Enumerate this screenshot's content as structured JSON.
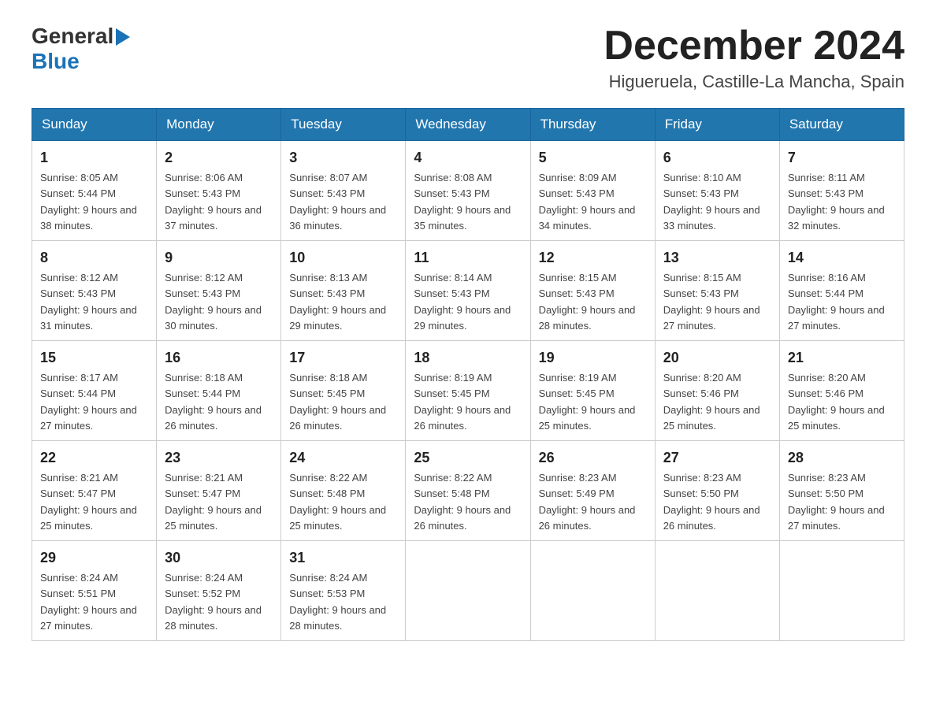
{
  "header": {
    "logo_general": "General",
    "logo_blue": "Blue",
    "month_title": "December 2024",
    "location": "Higueruela, Castille-La Mancha, Spain"
  },
  "days_of_week": [
    "Sunday",
    "Monday",
    "Tuesday",
    "Wednesday",
    "Thursday",
    "Friday",
    "Saturday"
  ],
  "weeks": [
    [
      {
        "day": "1",
        "sunrise": "8:05 AM",
        "sunset": "5:44 PM",
        "daylight": "9 hours and 38 minutes."
      },
      {
        "day": "2",
        "sunrise": "8:06 AM",
        "sunset": "5:43 PM",
        "daylight": "9 hours and 37 minutes."
      },
      {
        "day": "3",
        "sunrise": "8:07 AM",
        "sunset": "5:43 PM",
        "daylight": "9 hours and 36 minutes."
      },
      {
        "day": "4",
        "sunrise": "8:08 AM",
        "sunset": "5:43 PM",
        "daylight": "9 hours and 35 minutes."
      },
      {
        "day": "5",
        "sunrise": "8:09 AM",
        "sunset": "5:43 PM",
        "daylight": "9 hours and 34 minutes."
      },
      {
        "day": "6",
        "sunrise": "8:10 AM",
        "sunset": "5:43 PM",
        "daylight": "9 hours and 33 minutes."
      },
      {
        "day": "7",
        "sunrise": "8:11 AM",
        "sunset": "5:43 PM",
        "daylight": "9 hours and 32 minutes."
      }
    ],
    [
      {
        "day": "8",
        "sunrise": "8:12 AM",
        "sunset": "5:43 PM",
        "daylight": "9 hours and 31 minutes."
      },
      {
        "day": "9",
        "sunrise": "8:12 AM",
        "sunset": "5:43 PM",
        "daylight": "9 hours and 30 minutes."
      },
      {
        "day": "10",
        "sunrise": "8:13 AM",
        "sunset": "5:43 PM",
        "daylight": "9 hours and 29 minutes."
      },
      {
        "day": "11",
        "sunrise": "8:14 AM",
        "sunset": "5:43 PM",
        "daylight": "9 hours and 29 minutes."
      },
      {
        "day": "12",
        "sunrise": "8:15 AM",
        "sunset": "5:43 PM",
        "daylight": "9 hours and 28 minutes."
      },
      {
        "day": "13",
        "sunrise": "8:15 AM",
        "sunset": "5:43 PM",
        "daylight": "9 hours and 27 minutes."
      },
      {
        "day": "14",
        "sunrise": "8:16 AM",
        "sunset": "5:44 PM",
        "daylight": "9 hours and 27 minutes."
      }
    ],
    [
      {
        "day": "15",
        "sunrise": "8:17 AM",
        "sunset": "5:44 PM",
        "daylight": "9 hours and 27 minutes."
      },
      {
        "day": "16",
        "sunrise": "8:18 AM",
        "sunset": "5:44 PM",
        "daylight": "9 hours and 26 minutes."
      },
      {
        "day": "17",
        "sunrise": "8:18 AM",
        "sunset": "5:45 PM",
        "daylight": "9 hours and 26 minutes."
      },
      {
        "day": "18",
        "sunrise": "8:19 AM",
        "sunset": "5:45 PM",
        "daylight": "9 hours and 26 minutes."
      },
      {
        "day": "19",
        "sunrise": "8:19 AM",
        "sunset": "5:45 PM",
        "daylight": "9 hours and 25 minutes."
      },
      {
        "day": "20",
        "sunrise": "8:20 AM",
        "sunset": "5:46 PM",
        "daylight": "9 hours and 25 minutes."
      },
      {
        "day": "21",
        "sunrise": "8:20 AM",
        "sunset": "5:46 PM",
        "daylight": "9 hours and 25 minutes."
      }
    ],
    [
      {
        "day": "22",
        "sunrise": "8:21 AM",
        "sunset": "5:47 PM",
        "daylight": "9 hours and 25 minutes."
      },
      {
        "day": "23",
        "sunrise": "8:21 AM",
        "sunset": "5:47 PM",
        "daylight": "9 hours and 25 minutes."
      },
      {
        "day": "24",
        "sunrise": "8:22 AM",
        "sunset": "5:48 PM",
        "daylight": "9 hours and 25 minutes."
      },
      {
        "day": "25",
        "sunrise": "8:22 AM",
        "sunset": "5:48 PM",
        "daylight": "9 hours and 26 minutes."
      },
      {
        "day": "26",
        "sunrise": "8:23 AM",
        "sunset": "5:49 PM",
        "daylight": "9 hours and 26 minutes."
      },
      {
        "day": "27",
        "sunrise": "8:23 AM",
        "sunset": "5:50 PM",
        "daylight": "9 hours and 26 minutes."
      },
      {
        "day": "28",
        "sunrise": "8:23 AM",
        "sunset": "5:50 PM",
        "daylight": "9 hours and 27 minutes."
      }
    ],
    [
      {
        "day": "29",
        "sunrise": "8:24 AM",
        "sunset": "5:51 PM",
        "daylight": "9 hours and 27 minutes."
      },
      {
        "day": "30",
        "sunrise": "8:24 AM",
        "sunset": "5:52 PM",
        "daylight": "9 hours and 28 minutes."
      },
      {
        "day": "31",
        "sunrise": "8:24 AM",
        "sunset": "5:53 PM",
        "daylight": "9 hours and 28 minutes."
      },
      null,
      null,
      null,
      null
    ]
  ]
}
